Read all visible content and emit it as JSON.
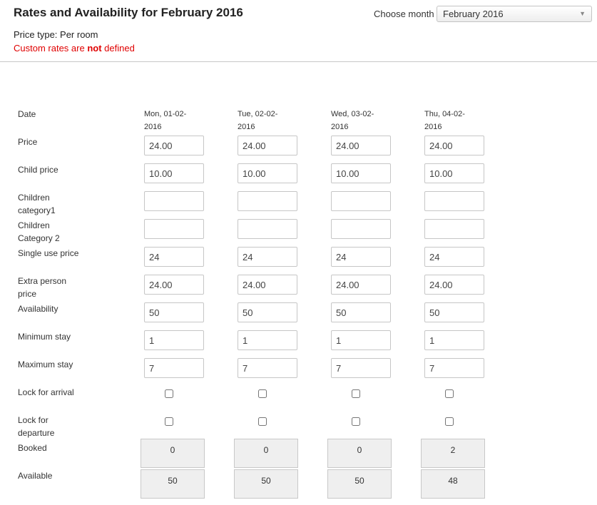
{
  "header": {
    "title": "Rates and Availability for February 2016",
    "price_type": "Price type: Per room",
    "custom_rates_prefix": "Custom rates are ",
    "custom_rates_emphasis": "not",
    "custom_rates_suffix": " defined"
  },
  "month_picker": {
    "label": "Choose month",
    "selected": "February 2016"
  },
  "row_labels": {
    "date": "Date",
    "price": "Price",
    "child_price": "Child price",
    "children_category1_a": "Children",
    "children_category1_b": "category1",
    "children_category2_a": "Children",
    "children_category2_b": "Category 2",
    "single_use_price": "Single use price",
    "extra_person_price_a": "Extra person",
    "extra_person_price_b": "price",
    "availability": "Availability",
    "minimum_stay": "Minimum stay",
    "maximum_stay": "Maximum stay",
    "lock_for_arrival": "Lock for arrival",
    "lock_for_departure_a": "Lock for",
    "lock_for_departure_b": "departure",
    "booked": "Booked",
    "available": "Available"
  },
  "days": [
    {
      "date_line1": "Mon, 01-02-",
      "date_line2": "2016",
      "price": "24.00",
      "child_price": "10.00",
      "children_category1": "",
      "children_category2": "",
      "single_use_price": "24",
      "extra_person_price": "24.00",
      "availability": "50",
      "minimum_stay": "1",
      "maximum_stay": "7",
      "lock_for_arrival": false,
      "lock_for_departure": false,
      "booked": "0",
      "available": "50"
    },
    {
      "date_line1": "Tue, 02-02-",
      "date_line2": "2016",
      "price": "24.00",
      "child_price": "10.00",
      "children_category1": "",
      "children_category2": "",
      "single_use_price": "24",
      "extra_person_price": "24.00",
      "availability": "50",
      "minimum_stay": "1",
      "maximum_stay": "7",
      "lock_for_arrival": false,
      "lock_for_departure": false,
      "booked": "0",
      "available": "50"
    },
    {
      "date_line1": "Wed, 03-02-",
      "date_line2": "2016",
      "price": "24.00",
      "child_price": "10.00",
      "children_category1": "",
      "children_category2": "",
      "single_use_price": "24",
      "extra_person_price": "24.00",
      "availability": "50",
      "minimum_stay": "1",
      "maximum_stay": "7",
      "lock_for_arrival": false,
      "lock_for_departure": false,
      "booked": "0",
      "available": "50"
    },
    {
      "date_line1": "Thu, 04-02-",
      "date_line2": "2016",
      "price": "24.00",
      "child_price": "10.00",
      "children_category1": "",
      "children_category2": "",
      "single_use_price": "24",
      "extra_person_price": "24.00",
      "availability": "50",
      "minimum_stay": "1",
      "maximum_stay": "7",
      "lock_for_arrival": false,
      "lock_for_departure": false,
      "booked": "2",
      "available": "48"
    }
  ]
}
